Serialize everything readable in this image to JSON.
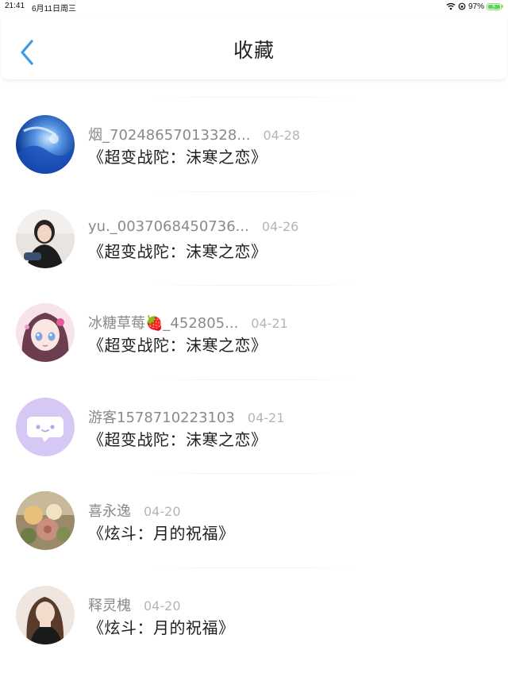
{
  "status_bar": {
    "time": "21:41",
    "date": "6月11日周三",
    "battery": "97%",
    "battery_level": 0.97
  },
  "header": {
    "title": "收藏"
  },
  "colors": {
    "accent": "#3a9bea",
    "title_text": "#222222",
    "username_text": "#8a8a8a",
    "date_text": "#b5b5b5",
    "battery_green": "#4cd964"
  },
  "favorites": [
    {
      "username": "烟_70248657013328...",
      "date": "04-28",
      "title": "《超变战陀：沫寒之恋》",
      "avatar": "blue-abstract-avatar"
    },
    {
      "username": "yu._0037068450736...",
      "date": "04-26",
      "title": "《超变战陀：沫寒之恋》",
      "avatar": "girl-photo-avatar"
    },
    {
      "username": "冰糖草莓🍓_452805...",
      "date": "04-21",
      "title": "《超变战陀：沫寒之恋》",
      "avatar": "anime-girl-avatar"
    },
    {
      "username": "游客1578710223103",
      "date": "04-21",
      "title": "《超变战陀：沫寒之恋》",
      "avatar": "chat-bubble-avatar"
    },
    {
      "username": "喜永逸",
      "date": "04-20",
      "title": "《炫斗：月的祝福》",
      "avatar": "flowers-avatar"
    },
    {
      "username": "释灵槐",
      "date": "04-20",
      "title": "《炫斗：月的祝福》",
      "avatar": "woman-photo-avatar"
    }
  ]
}
